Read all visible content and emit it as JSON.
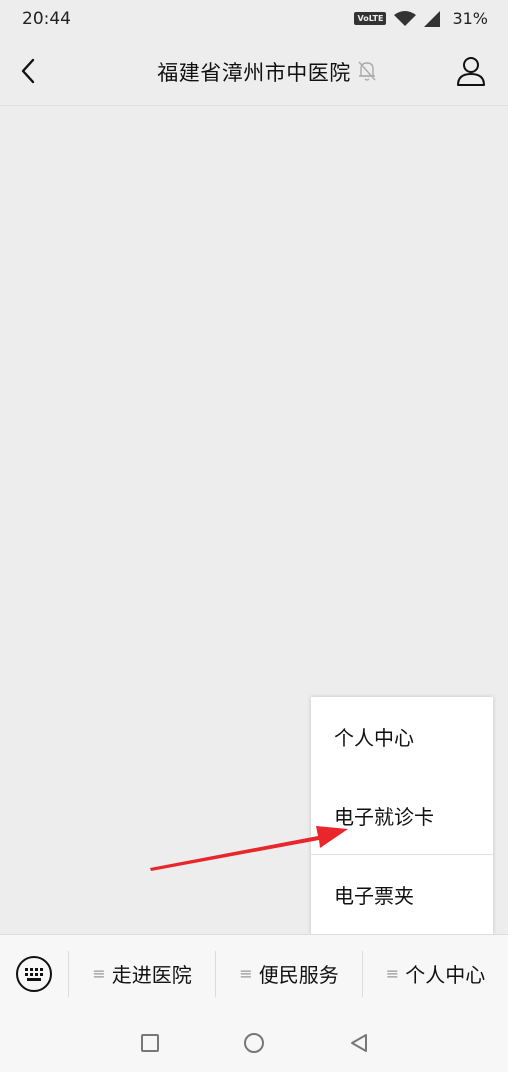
{
  "status": {
    "time": "20:44",
    "network": "VoLTE",
    "battery": "31%"
  },
  "header": {
    "title": "福建省漳州市中医院"
  },
  "popup": {
    "items": [
      {
        "label": "个人中心"
      },
      {
        "label": "电子就诊卡"
      },
      {
        "label": "电子票夹"
      }
    ]
  },
  "bottom_menu": {
    "tabs": [
      {
        "label": "走进医院"
      },
      {
        "label": "便民服务"
      },
      {
        "label": "个人中心"
      }
    ]
  },
  "colors": {
    "background": "#ededed",
    "arrow": "#e8262b",
    "menu_bg": "#f7f7f7"
  }
}
